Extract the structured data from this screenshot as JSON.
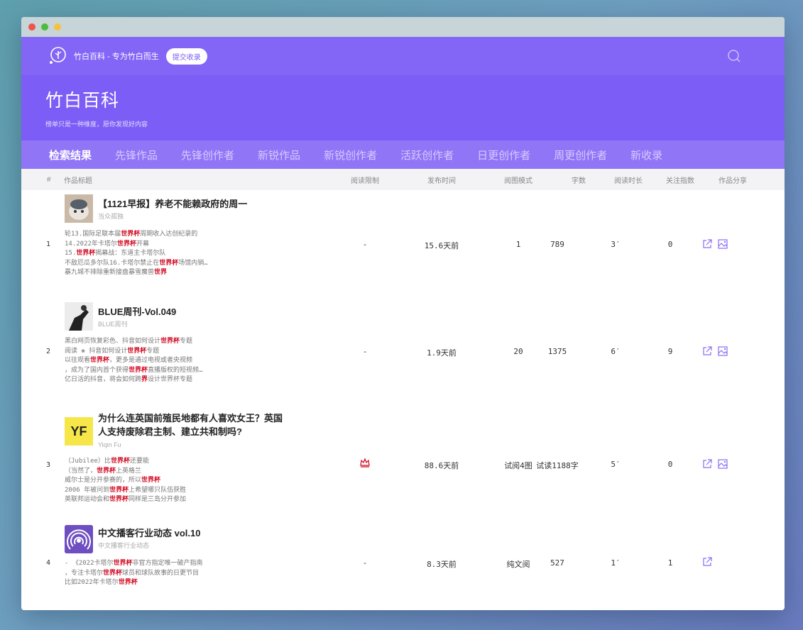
{
  "site": {
    "name": "竹白百科 - 专为竹白而生",
    "submit_label": "提交收录",
    "title": "竹白百科",
    "subtitle": "榜单只是一种维度，愿你发现好内容"
  },
  "tabs": [
    {
      "label": "检索结果"
    },
    {
      "label": "先锋作品"
    },
    {
      "label": "先锋创作者"
    },
    {
      "label": "新锐作品"
    },
    {
      "label": "新锐创作者"
    },
    {
      "label": "活跃创作者"
    },
    {
      "label": "日更创作者"
    },
    {
      "label": "周更创作者"
    },
    {
      "label": "新收录"
    }
  ],
  "columns": {
    "num": "#",
    "title": "作品标题",
    "read_limit": "阅读限制",
    "publish_time": "发布时间",
    "read_mode": "阅图模式",
    "words": "字数",
    "read_duration": "阅读时长",
    "follow_index": "关注指数",
    "share": "作品分享"
  },
  "rows": [
    {
      "num": "1",
      "title": "【1121早报】养老不能赖政府的周一",
      "author": "当众孤独",
      "excerpt": [
        [
          "轮13.国际足联本届",
          "世界杯",
          "周期收入达创纪录的"
        ],
        [
          "14.2022年卡塔尔",
          "世界杯",
          "开幕"
        ],
        [
          "15.",
          "世界杯",
          "揭幕战：东道主卡塔尔队"
        ],
        [
          "不敌厄瓜多尔队16.卡塔尔禁止在",
          "世界杯",
          "场馆内销…"
        ],
        [
          "暴九城不排除重新接盘暴雪魔兽",
          "世界",
          ""
        ]
      ],
      "read_limit": "-",
      "publish_time": "15.6天前",
      "read_mode": "1",
      "words": "789",
      "read_duration": "3′",
      "follow_index": "0"
    },
    {
      "num": "2",
      "title": "BLUE周刊-Vol.049",
      "author": "BLUE周刊",
      "excerpt": [
        [
          "黑白网页恢复彩色、抖音如何设计",
          "世界杯",
          "专题"
        ],
        [
          "阅读 ❀ 抖音如何设计",
          "世界杯",
          "专题"
        ],
        [
          "以往观看",
          "世界杯",
          "，更多是通过电视或者央视频"
        ],
        [
          "，成为了国内首个获得",
          "世界杯",
          "直播版权的短视频…"
        ],
        [
          "亿日活的抖音，将会如何跨",
          "界",
          "设计世界杯专题"
        ]
      ],
      "read_limit": "-",
      "publish_time": "1.9天前",
      "read_mode": "20",
      "words": "1375",
      "read_duration": "6′",
      "follow_index": "9"
    },
    {
      "num": "3",
      "title_lines": [
        "为什么连英国前殖民地都有人喜欢女王？英国",
        "人支持废除君主制、建立共和制吗?"
      ],
      "avatar_text": "YF",
      "author": "Yiqin Fu",
      "excerpt": [
        [
          "（Jubilee）比",
          "世界杯",
          "还要能"
        ],
        [
          "（当然了，",
          "世界杯",
          "上英格兰"
        ],
        [
          "威尔士是分开参赛的，所以",
          "世界杯",
          ""
        ],
        [
          "2006 年被问到",
          "世界杯",
          "上希望哪只队伍获胜"
        ],
        [
          "英联邦运动会和",
          "世界杯",
          "同样是三岛分开参加"
        ]
      ],
      "read_limit": "crown",
      "publish_time": "88.6天前",
      "read_mode": "试阅4图",
      "words": "试读1188字",
      "read_duration": "5′",
      "follow_index": "0"
    },
    {
      "num": "4",
      "title": "中文播客行业动态 vol.10",
      "author": "中文播客行业动态",
      "excerpt": [
        [
          "- 《2022卡塔尔",
          "世界杯",
          "非官方指定唯一破产指南"
        ],
        [
          "，专注卡塔尔",
          "世界杯",
          "球员和球队故事的日更节目"
        ],
        [
          "比如2022年卡塔尔",
          "世界杯",
          ""
        ]
      ],
      "read_limit": "-",
      "publish_time": "8.3天前",
      "read_mode": "纯文阅",
      "words": "527",
      "read_duration": "1′",
      "follow_index": "1"
    }
  ],
  "colors": {
    "topbar": "#8366f6",
    "hero": "#7c5ef6",
    "tabs": "#9175f7",
    "highlight": "#d0021b",
    "share_icon": "#8b6cf5"
  },
  "icons": {
    "logo": "bamboo-logo-icon",
    "search": "search-icon",
    "share_link": "external-link-icon",
    "share_image": "image-share-icon",
    "crown": "crown-icon"
  }
}
